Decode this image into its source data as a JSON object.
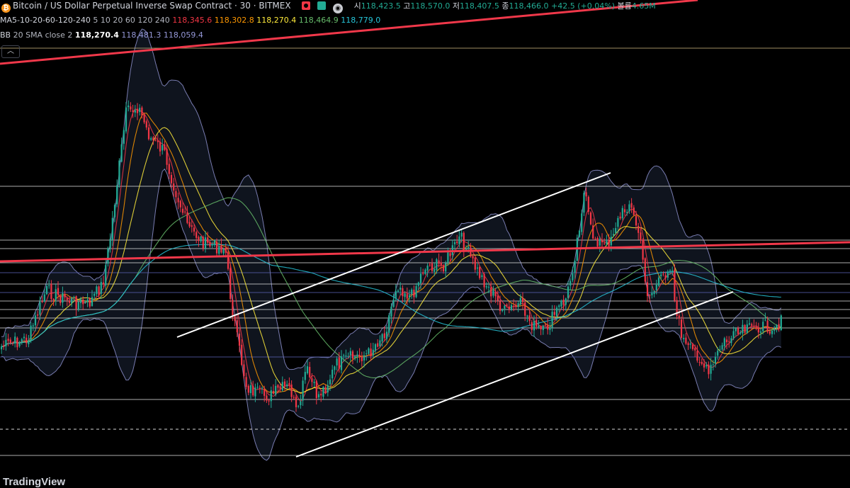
{
  "header": {
    "coin_icon": "bitcoin-icon",
    "title": "Bitcoin / US Dollar Perpetual Inverse Swap Contract · 30 · BITMEX",
    "ohlc": [
      {
        "label": "시",
        "value": "118,423.5"
      },
      {
        "label": "고",
        "value": "118,570.0"
      },
      {
        "label": "저",
        "value": "118,407.5"
      },
      {
        "label": "종",
        "value": "118,466.0"
      }
    ],
    "change": "+42.5 (+0.04%)",
    "volume_label": "볼륨",
    "volume_value": "4.65M"
  },
  "ma_legend": {
    "name": "MA5-10-20-60-120-240",
    "params": "5 10 20 60 120 240",
    "values": [
      {
        "value": "118,345.6",
        "color": "#f23645"
      },
      {
        "value": "118,302.8",
        "color": "#ff9800"
      },
      {
        "value": "118,270.4",
        "color": "#ffeb3b"
      },
      {
        "value": "118,464.9",
        "color": "#66bb6a"
      },
      {
        "value": "118,779.0",
        "color": "#26c6da"
      }
    ]
  },
  "bb_legend": {
    "name": "BB",
    "params": "20 SMA close 2",
    "basis": "118,270.4",
    "upper": "118,481.3",
    "lower": "118,059.4",
    "basis_color": "#ffffff",
    "band_color": "#9598d8"
  },
  "collapse_icon": "chevron-up-icon",
  "footer": {
    "logo": "TradingView"
  },
  "colors": {
    "up": "#22ab94",
    "down": "#f23645",
    "trendline": "#ffffff",
    "resistance": "#f0384a",
    "background": "#000000"
  }
}
